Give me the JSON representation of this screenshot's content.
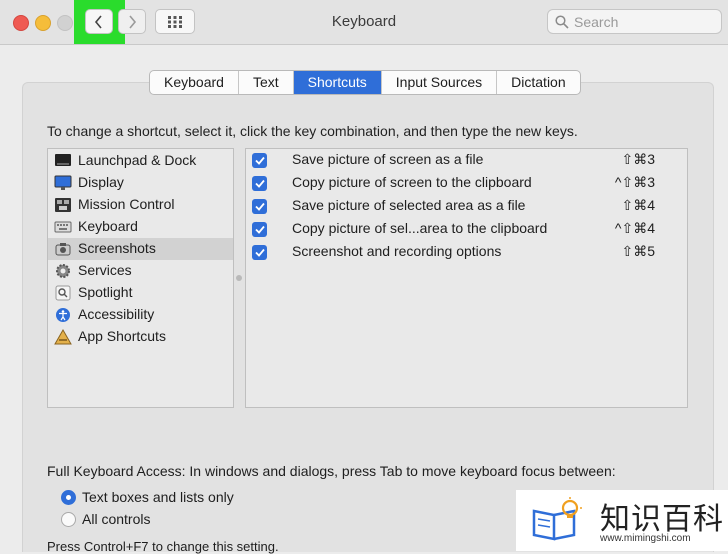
{
  "window": {
    "title": "Keyboard"
  },
  "search": {
    "placeholder": "Search"
  },
  "tabs": [
    {
      "label": "Keyboard",
      "active": false
    },
    {
      "label": "Text",
      "active": false
    },
    {
      "label": "Shortcuts",
      "active": true
    },
    {
      "label": "Input Sources",
      "active": false
    },
    {
      "label": "Dictation",
      "active": false
    }
  ],
  "instruction": "To change a shortcut, select it, click the key combination, and then type the new keys.",
  "categories": [
    {
      "label": "Launchpad & Dock",
      "icon": "launchpad-dock-icon"
    },
    {
      "label": "Display",
      "icon": "display-icon"
    },
    {
      "label": "Mission Control",
      "icon": "mission-control-icon"
    },
    {
      "label": "Keyboard",
      "icon": "keyboard-icon"
    },
    {
      "label": "Screenshots",
      "icon": "screenshots-icon",
      "selected": true
    },
    {
      "label": "Services",
      "icon": "services-gear-icon"
    },
    {
      "label": "Spotlight",
      "icon": "spotlight-icon"
    },
    {
      "label": "Accessibility",
      "icon": "accessibility-icon"
    },
    {
      "label": "App Shortcuts",
      "icon": "app-shortcuts-icon"
    }
  ],
  "shortcuts": [
    {
      "label": "Save picture of screen as a file",
      "keys": "⇧⌘3",
      "checked": true
    },
    {
      "label": "Copy picture of screen to the clipboard",
      "keys": "^⇧⌘3",
      "checked": true
    },
    {
      "label": "Save picture of selected area as a file",
      "keys": "⇧⌘4",
      "checked": true
    },
    {
      "label": "Copy picture of sel...area to the clipboard",
      "keys": "^⇧⌘4",
      "checked": true
    },
    {
      "label": "Screenshot and recording options",
      "keys": "⇧⌘5",
      "checked": true
    }
  ],
  "full_keyboard_access": {
    "label": "Full Keyboard Access: In windows and dialogs, press Tab to move keyboard focus between:",
    "options": [
      {
        "label": "Text boxes and lists only",
        "selected": true
      },
      {
        "label": "All controls",
        "selected": false
      }
    ],
    "note": "Press Control+F7 to change this setting."
  },
  "watermark": {
    "text": "知识百科",
    "url": "www.mimingshi.com"
  },
  "colors": {
    "accent": "#2f6ed8",
    "highlight": "#2adc2c"
  }
}
